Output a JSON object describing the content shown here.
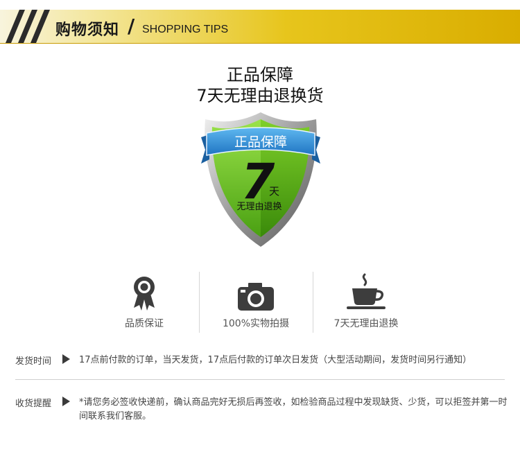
{
  "header": {
    "title": "购物须知",
    "slash": "/",
    "subtitle": "SHOPPING TIPS"
  },
  "headline": {
    "line1": "正品保障",
    "line2": "7天无理由退换货"
  },
  "shield": {
    "ribbon": "正品保障",
    "big_number": "7",
    "day": "天",
    "caption": "无理由退换"
  },
  "features": [
    {
      "icon": "award-ribbon-icon",
      "label": "品质保证"
    },
    {
      "icon": "camera-icon",
      "label": "100%实物拍摄"
    },
    {
      "icon": "coffee-cup-icon",
      "label": "7天无理由退换"
    }
  ],
  "info": {
    "shipping": {
      "label": "发货时间",
      "text": "17点前付款的订单，当天发货，17点后付款的订单次日发货（大型活动期间，发货时间另行通知）"
    },
    "receiving": {
      "label": "收货提醒",
      "text": "*请您务必签收快递前，确认商品完好无损后再签收，如检验商品过程中发现缺货、少货，可以拒签并第一时间联系我们客服。"
    }
  },
  "colors": {
    "banner_gold": "#e7c51c",
    "shield_green": "#66c51e",
    "ribbon_blue": "#2a8fd8"
  }
}
